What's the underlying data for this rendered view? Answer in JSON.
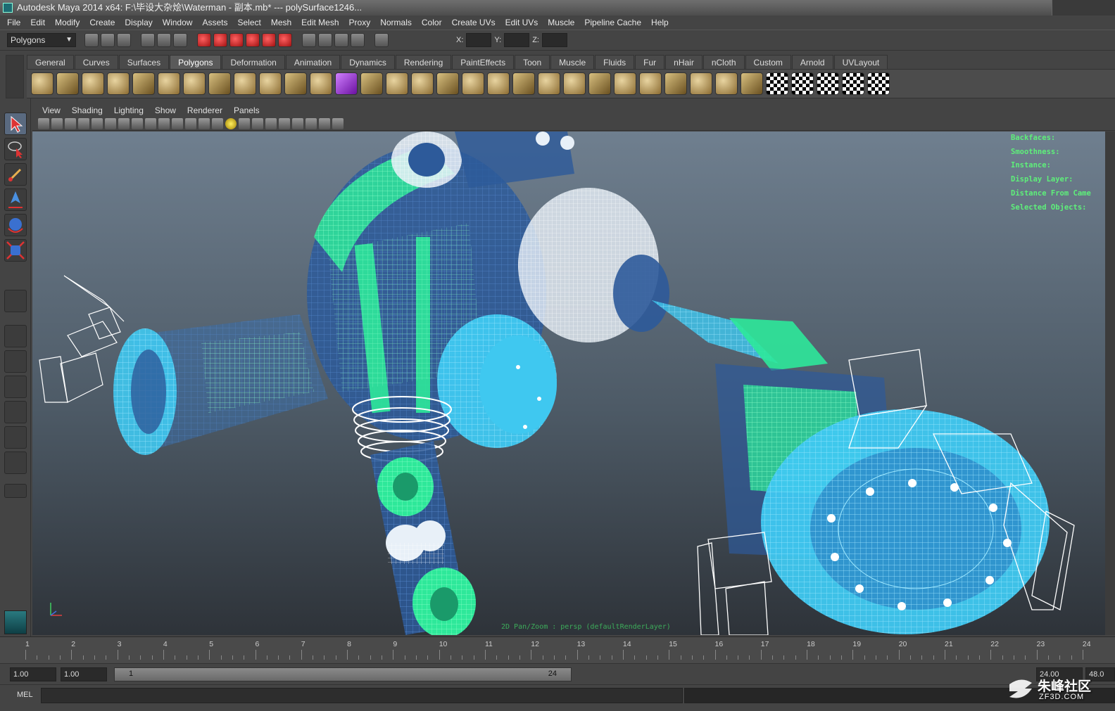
{
  "window": {
    "title": "Autodesk Maya 2014 x64: F:\\毕设大杂烩\\Waterman - 副本.mb*  ---  polySurface1246..."
  },
  "menu": [
    "File",
    "Edit",
    "Modify",
    "Create",
    "Display",
    "Window",
    "Assets",
    "Select",
    "Mesh",
    "Edit Mesh",
    "Proxy",
    "Normals",
    "Color",
    "Create UVs",
    "Edit UVs",
    "Muscle",
    "Pipeline Cache",
    "Help"
  ],
  "status_line": {
    "mode": "Polygons",
    "x_label": "X:",
    "y_label": "Y:",
    "z_label": "Z:"
  },
  "shelf_tabs": [
    {
      "label": "General",
      "active": false
    },
    {
      "label": "Curves",
      "active": false
    },
    {
      "label": "Surfaces",
      "active": false
    },
    {
      "label": "Polygons",
      "active": true
    },
    {
      "label": "Deformation",
      "active": false
    },
    {
      "label": "Animation",
      "active": false
    },
    {
      "label": "Dynamics",
      "active": false
    },
    {
      "label": "Rendering",
      "active": false
    },
    {
      "label": "PaintEffects",
      "active": false
    },
    {
      "label": "Toon",
      "active": false
    },
    {
      "label": "Muscle",
      "active": false
    },
    {
      "label": "Fluids",
      "active": false
    },
    {
      "label": "Fur",
      "active": false
    },
    {
      "label": "nHair",
      "active": false
    },
    {
      "label": "nCloth",
      "active": false
    },
    {
      "label": "Custom",
      "active": false
    },
    {
      "label": "Arnold",
      "active": false
    },
    {
      "label": "UVLayout",
      "active": false
    }
  ],
  "panel_menu": [
    "View",
    "Shading",
    "Lighting",
    "Show",
    "Renderer",
    "Panels"
  ],
  "hud": {
    "lines": [
      "Backfaces:",
      "Smoothness:",
      "Instance:",
      "Display Layer:",
      "Distance From Came",
      "Selected Objects:"
    ],
    "status": "2D Pan/Zoom : persp (defaultRenderLayer)",
    "color": "#5ef07a"
  },
  "timeline": {
    "ticks": [
      1,
      2,
      3,
      4,
      5,
      6,
      7,
      8,
      9,
      10,
      11,
      12,
      13,
      14,
      15,
      16,
      17,
      18,
      19,
      20,
      21,
      22,
      23,
      24
    ],
    "current": "24"
  },
  "range": {
    "start": "1.00",
    "start_inner": "1.00",
    "slider_start": "1",
    "slider_end": "24",
    "end_inner": "24.00",
    "end": "48.0"
  },
  "command_line": {
    "label": "MEL"
  },
  "watermark": {
    "main": "朱峰社区",
    "sub": "ZF3D.COM"
  },
  "colors": {
    "wire_blue": "#3fc8f0",
    "wire_green": "#2ee89a",
    "wire_dark": "#2d5a9a",
    "wire_white": "#e8f0f8"
  }
}
